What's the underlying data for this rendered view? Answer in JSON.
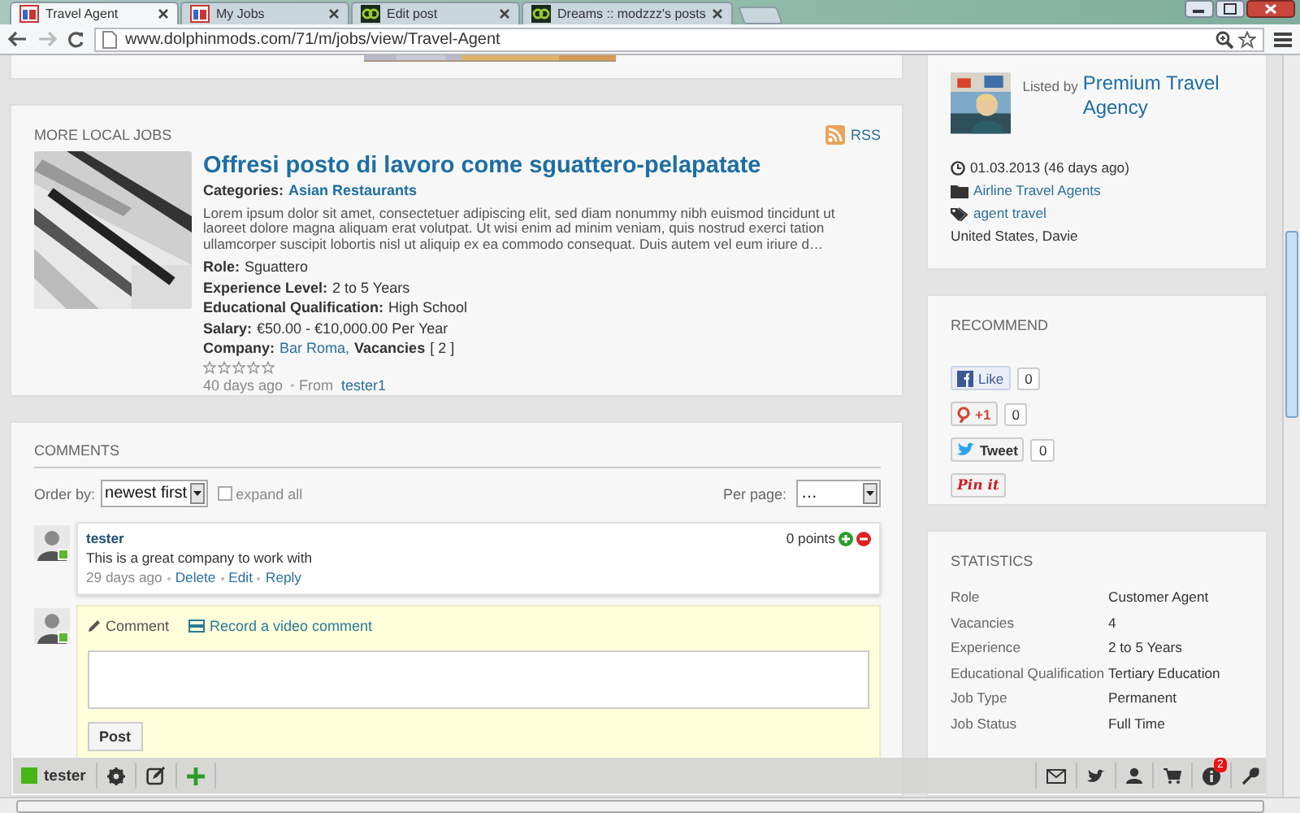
{
  "browser": {
    "tabs": [
      {
        "title": "Travel Agent",
        "selected": true,
        "kind": "jobs"
      },
      {
        "title": "My Jobs",
        "selected": false,
        "kind": "jobs"
      },
      {
        "title": "Edit post",
        "selected": false,
        "kind": "dreams"
      },
      {
        "title": "Dreams :: modzzz's posts",
        "selected": false,
        "kind": "dreams"
      }
    ],
    "url": "www.dolphinmods.com/71/m/jobs/view/Travel-Agent"
  },
  "more_local_jobs": {
    "title": "MORE LOCAL JOBS",
    "rss": "RSS",
    "job": {
      "title": "Offresi posto di lavoro come sguattero-pelapatate",
      "categories_label": "Categories:",
      "category": "Asian Restaurants",
      "description": "Lorem ipsum dolor sit amet, consectetuer adipiscing elit, sed diam nonummy nibh euismod tincidunt ut laoreet dolore magna aliquam erat volutpat. Ut wisi enim ad minim veniam, quis nostrud exerci tation ullamcorper suscipit lobortis nisl ut aliquip ex ea commodo consequat. Duis autem vel eum iriure d…",
      "fields": [
        {
          "label": "Role:",
          "value": "Sguattero"
        },
        {
          "label": "Experience Level:",
          "value": "2 to 5 Years"
        },
        {
          "label": "Educational Qualification:",
          "value": "High School"
        },
        {
          "label": "Salary:",
          "value": "€50.00 - €10,000.00 Per Year"
        }
      ],
      "company_label": "Company:",
      "company": "Bar Roma,",
      "vacancies_label": "Vacancies",
      "vacancies": "[ 2 ]",
      "stars": 0,
      "age": "40 days ago",
      "from_label": "From",
      "author": "tester1"
    }
  },
  "comments": {
    "title": "COMMENTS",
    "order_label": "Order by:",
    "order_value": "newest first",
    "expand_all": {
      "label": "expand all",
      "checked": false
    },
    "per_page_label": "Per page:",
    "per_page_value": "…",
    "items": [
      {
        "author": "tester",
        "text": "This is a great company to work with",
        "age": "29 days ago",
        "actions": [
          "Delete",
          "Edit",
          "Reply"
        ],
        "points": "0 points"
      }
    ],
    "form": {
      "tabs": [
        {
          "label": "Comment",
          "kind": "text",
          "selected": true
        },
        {
          "label": "Record a video comment",
          "kind": "video",
          "selected": false
        }
      ],
      "post": "Post"
    }
  },
  "listing": {
    "listed_by": "Listed by",
    "agency": "Premium Travel Agency",
    "date": "01.03.2013 (46 days ago)",
    "category": "Airline Travel Agents",
    "tags": "agent travel",
    "location": "United States, Davie"
  },
  "recommend": {
    "title": "RECOMMEND",
    "buttons": [
      {
        "kind": "facebook",
        "label": "Like",
        "count": "0"
      },
      {
        "kind": "google",
        "label": "+1",
        "count": "0"
      },
      {
        "kind": "twitter",
        "label": "Tweet",
        "count": "0"
      },
      {
        "kind": "pinterest",
        "label": "Pin it"
      }
    ]
  },
  "statistics": {
    "title": "STATISTICS",
    "rows": [
      {
        "label": "Role",
        "value": "Customer Agent"
      },
      {
        "label": "Vacancies",
        "value": "4"
      },
      {
        "label": "Experience",
        "value": "2 to 5 Years"
      },
      {
        "label": "Educational Qualification",
        "value": "Tertiary Education"
      },
      {
        "label": "Job Type",
        "value": "Permanent"
      },
      {
        "label": "Job Status",
        "value": "Full Time"
      }
    ]
  },
  "toolbar": {
    "user": "tester",
    "notifications": "2"
  }
}
